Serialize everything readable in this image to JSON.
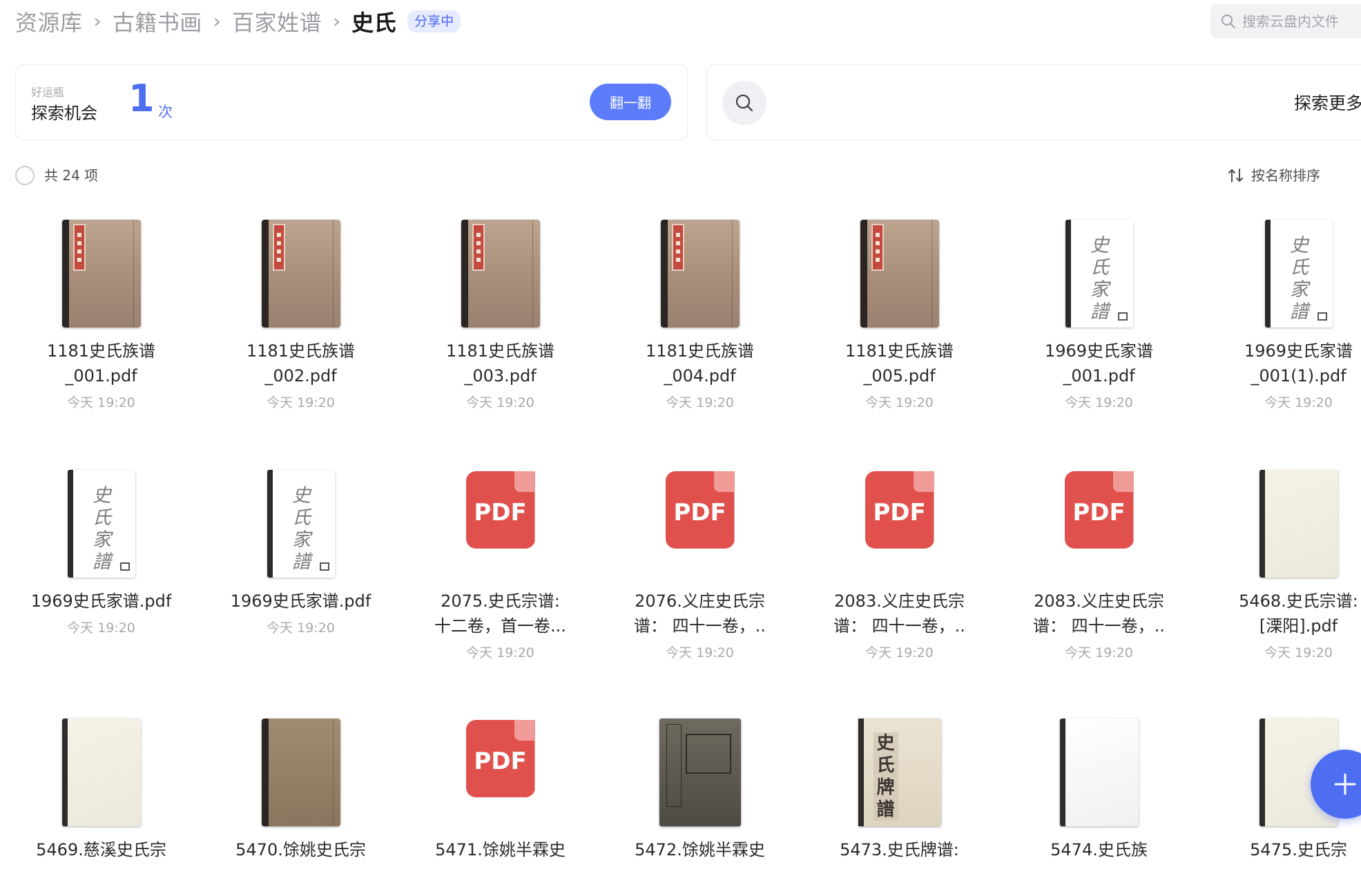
{
  "breadcrumb": {
    "items": [
      "资源库",
      "古籍书画",
      "百家姓谱",
      "史氏"
    ],
    "separator": "›",
    "badge": "分享中"
  },
  "search": {
    "placeholder": "搜索云盘内文件"
  },
  "luck": {
    "small_label": "好运瓶",
    "title": "探索机会",
    "count": "1",
    "unit": "次",
    "button": "翻一翻"
  },
  "explore": {
    "text": "探索更多"
  },
  "toolbar": {
    "count_label": "共 24 项",
    "sort_label": "按名称排序"
  },
  "icons": {
    "search": "search-icon",
    "sort": "sort-arrows-icon",
    "plus": "plus-icon",
    "checkbox": "circle-checkbox-icon"
  },
  "colors": {
    "accent": "#4e6ef2",
    "pdf_red": "#e0514d",
    "muted": "#a7a9ae"
  },
  "files": [
    {
      "name": "1181史氏族谱\n_001.pdf",
      "time": "今天 19:20",
      "thumb": "book"
    },
    {
      "name": "1181史氏族谱\n_002.pdf",
      "time": "今天 19:20",
      "thumb": "book"
    },
    {
      "name": "1181史氏族谱\n_003.pdf",
      "time": "今天 19:20",
      "thumb": "book"
    },
    {
      "name": "1181史氏族谱\n_004.pdf",
      "time": "今天 19:20",
      "thumb": "book"
    },
    {
      "name": "1181史氏族谱\n_005.pdf",
      "time": "今天 19:20",
      "thumb": "book"
    },
    {
      "name": "1969史氏家谱\n_001.pdf",
      "time": "今天 19:20",
      "thumb": "paper"
    },
    {
      "name": "1969史氏家谱\n_001(1).pdf",
      "time": "今天 19:20",
      "thumb": "paper"
    },
    {
      "name": "1969史氏家谱.pdf",
      "time": "今天 19:20",
      "thumb": "paper"
    },
    {
      "name": "1969史氏家谱.pdf",
      "time": "今天 19:20",
      "thumb": "paper"
    },
    {
      "name": "2075.史氏宗谱:\n十二卷，首一卷...",
      "time": "今天 19:20",
      "thumb": "pdf"
    },
    {
      "name": "2076.义庄史氏宗\n谱： 四十一卷，..",
      "time": "今天 19:20",
      "thumb": "pdf"
    },
    {
      "name": "2083.义庄史氏宗\n谱： 四十一卷，..",
      "time": "今天 19:20",
      "thumb": "pdf"
    },
    {
      "name": "2083.义庄史氏宗\n谱： 四十一卷，..",
      "time": "今天 19:20",
      "thumb": "pdf"
    },
    {
      "name": "5468.史氏宗谱:\n[溧阳].pdf",
      "time": "今天 19:20",
      "thumb": "blank"
    },
    {
      "name": "5469.慈溪史氏宗",
      "time": "",
      "thumb": "blank"
    },
    {
      "name": "5470.馀姚史氏宗",
      "time": "",
      "thumb": "bookplain"
    },
    {
      "name": "5471.馀姚半霖史",
      "time": "",
      "thumb": "pdf"
    },
    {
      "name": "5472.馀姚半霖史",
      "time": "",
      "thumb": "dark"
    },
    {
      "name": "5473.史氏牌谱:",
      "time": "",
      "thumb": "cream"
    },
    {
      "name": "5474.史氏族",
      "time": "",
      "thumb": "white"
    },
    {
      "name": "5475.史氏宗",
      "time": "",
      "thumb": "blank"
    }
  ],
  "pdf_label": "PDF",
  "thumb_text": {
    "paper_calli": "史氏家譜",
    "cream_title": "史氏牌譜"
  }
}
